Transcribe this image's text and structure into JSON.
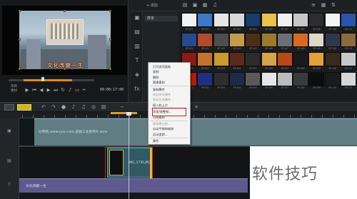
{
  "preview": {
    "overlay_caption": "文化改變一生",
    "mode_labels": [
      "项目",
      "素材"
    ],
    "timecode": "00:00:17:00"
  },
  "library": {
    "add_label": "+ 添加",
    "folder_name": "样本",
    "thumb_colors": [
      [
        "#f2f2f2",
        "#3b79c6",
        "#e6e6e6",
        "#d8d8d8",
        "#1a3a6a",
        "#e8c24a",
        "#f0f0f0",
        "#c7c7c7",
        "#2d2d2d",
        "#f5f5f5",
        "#2956a8"
      ],
      [
        "#264a8c",
        "#b24b2c",
        "#4e4e4e",
        "#c39b4a",
        "#4b2f18",
        "#9c7a2c",
        "#6c6f73",
        "#d86a20",
        "#e0d9c7",
        "#2e3a4a",
        "#8b6b3b"
      ],
      [
        "#8a1c14",
        "#c4742a",
        "#c99a2c",
        "#5a2a1a",
        "#2c2c2c",
        "#d7a24a",
        "#b84818",
        "#1a1a1a",
        "#e3a03a",
        "#3a2a1a",
        "#c8c8c8"
      ],
      [
        "#b41c0c",
        "#203080",
        "#2e2e2e",
        "#1e2a4a",
        "#5a5a5a",
        "#e6e6e6",
        "#bcbcbc",
        "#3a3a3a",
        "#0d0d0d",
        "#1b1b1b",
        "#d6d6d6"
      ]
    ],
    "thumb_labels": [
      "SP-I01",
      "SP-I02",
      "SP-I03",
      "SP-I04",
      "SP-I05",
      "SP-I06",
      "SP-I07",
      "SP-I08",
      "SP-I09",
      "SP-I10",
      "SP-I11"
    ]
  },
  "context_menu": {
    "items": [
      {
        "label": "打开选项面板",
        "disabled": false
      },
      {
        "label": "复制",
        "disabled": false
      },
      {
        "label": "删除",
        "disabled": false
      },
      {
        "label": "替换素材",
        "disabled": false
      },
      {
        "label": "复制属性",
        "disabled": false
      },
      {
        "label": "粘贴所有属性",
        "disabled": true
      },
      {
        "label": "粘贴可选属性...",
        "disabled": true
      },
      {
        "label": "插入轨上方",
        "disabled": false
      },
      {
        "label": "添加/调整帧...",
        "disabled": false
      },
      {
        "label": "分割素材",
        "disabled": false
      },
      {
        "label": "按场景分割...",
        "disabled": true
      },
      {
        "label": "自动平移和缩放",
        "disabled": false
      },
      {
        "label": "运动追踪...",
        "disabled": false
      },
      {
        "label": "属性",
        "disabled": false
      }
    ],
    "highlighted_label": "添加/调整帧..."
  },
  "timeline": {
    "video_clip_label": "分界网_www.sysc.com_航拍工业宣传片.wmv",
    "overlay_clip_label": "IMG_1735.JPG",
    "title_clip_label": "文化改變一生"
  },
  "watermark": "软件技巧",
  "colors": {
    "highlight_red": "#d8231c",
    "accent_orange": "#e4871f",
    "accent_yellow": "#ccb42a"
  }
}
